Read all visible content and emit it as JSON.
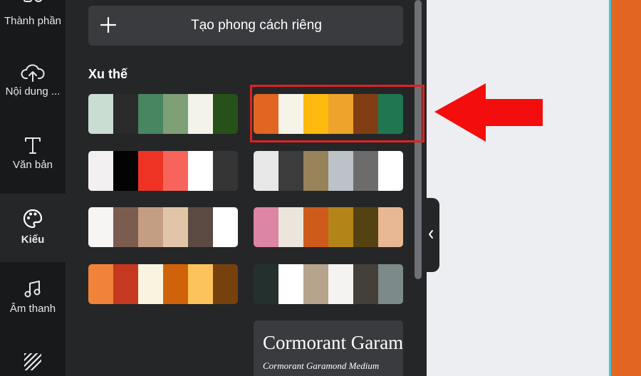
{
  "sidebar": {
    "items": [
      {
        "label": "Thành phần",
        "icon": "elements-icon"
      },
      {
        "label": "Nội dung ...",
        "icon": "upload-cloud-icon"
      },
      {
        "label": "Văn bản",
        "icon": "text-icon"
      },
      {
        "label": "Kiểu",
        "icon": "palette-icon",
        "active": true
      },
      {
        "label": "Âm thanh",
        "icon": "music-note-icon"
      },
      {
        "label": "",
        "icon": "background-pattern-icon"
      }
    ]
  },
  "panel": {
    "create_button_label": "Tạo phong cách riêng",
    "section_title": "Xu thế",
    "palettes": [
      [
        "#c9ddd2",
        "#2b2b2b",
        "#478660",
        "#7f9f77",
        "#f3f3ea",
        "#265118"
      ],
      [
        "#e06622",
        "#f6f3e9",
        "#fdb90d",
        "#eea32c",
        "#803e12",
        "#1f7650"
      ],
      [
        "#f2f0f0",
        "#030303",
        "#ee3325",
        "#f7645b",
        "#ffffff",
        "#353535"
      ],
      [
        "#e7e7e7",
        "#3c3c3c",
        "#98825a",
        "#bcc2c8",
        "#6c6c6c",
        "#ffffff"
      ],
      [
        "#f7f5f3",
        "#7b5d4f",
        "#c49e83",
        "#e2c5a8",
        "#5b4a41",
        "#ffffff"
      ],
      [
        "#dd85a4",
        "#ebe5dc",
        "#ce5b1b",
        "#b38418",
        "#544212",
        "#e8b894"
      ],
      [
        "#f08339",
        "#c6381f",
        "#f8f4df",
        "#d0620a",
        "#fcc35c",
        "#76410d"
      ],
      [
        "#24302e",
        "#ffffff",
        "#b7a48c",
        "#f4f3f1",
        "#443f38",
        "#7c8b8a"
      ]
    ],
    "font_preview": {
      "heading": "Cormorant Garamond",
      "subheading": "Cormorant Garamond Medium"
    }
  },
  "colors": {
    "rail_bg": "#18191b",
    "panel_bg": "#252628",
    "accent_orange": "#e06622",
    "highlight_red": "#e0221f",
    "arrow_red": "#f40d0d"
  }
}
